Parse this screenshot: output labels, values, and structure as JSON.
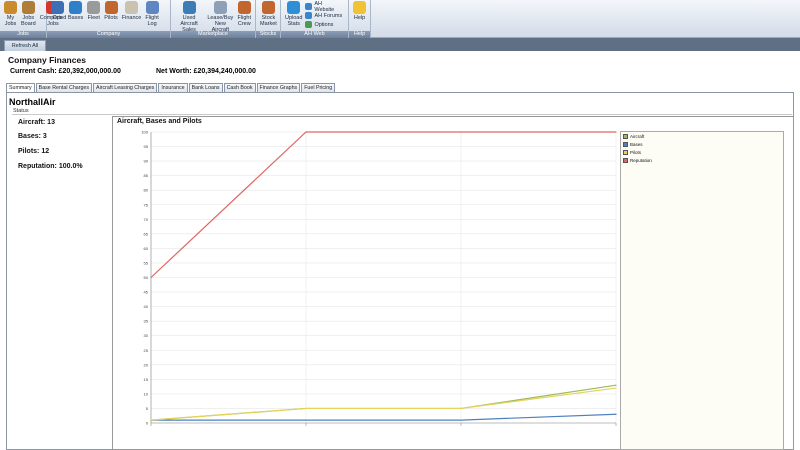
{
  "ribbon": {
    "groups": [
      {
        "label": "Jobs",
        "buttons": [
          {
            "label": "My\nJobs",
            "icon": "briefcase-icon",
            "color": "#c98b2c"
          },
          {
            "label": "Jobs\nBoard",
            "icon": "clipboard-icon",
            "color": "#b07c3a"
          },
          {
            "label": "Completed\nJobs",
            "icon": "checkmark-icon",
            "color": "#d6352b"
          }
        ]
      },
      {
        "label": "Company",
        "buttons": [
          {
            "label": "Ops",
            "icon": "people-icon",
            "color": "#3c6fb6"
          },
          {
            "label": "Bases",
            "icon": "globe-icon",
            "color": "#2f7fc9"
          },
          {
            "label": "Fleet",
            "icon": "airplane-icon",
            "color": "#9a9a9a"
          },
          {
            "label": "Pilots",
            "icon": "pilot-icon",
            "color": "#c0662e"
          },
          {
            "label": "Finance",
            "icon": "money-icon",
            "color": "#c9c2b0"
          },
          {
            "label": "Flight\nLog",
            "icon": "logbook-icon",
            "color": "#5e86c2"
          }
        ]
      },
      {
        "label": "Marketplace",
        "buttons": [
          {
            "label": "Used Aircraft\nSales",
            "icon": "sales-icon",
            "color": "#3d7db5"
          },
          {
            "label": "Lease/Buy\nNew Aircraft",
            "icon": "new-aircraft-icon",
            "color": "#8da0b8"
          },
          {
            "label": "Flight\nCrew",
            "icon": "crew-icon",
            "color": "#c0662e"
          }
        ]
      },
      {
        "label": "Stocks",
        "buttons": [
          {
            "label": "Stock\nMarket",
            "icon": "stock-icon",
            "color": "#c0662e"
          }
        ]
      },
      {
        "label": "AH Web",
        "buttons": [
          {
            "label": "Upload\nStats",
            "icon": "upload-icon",
            "color": "#2f8fd6"
          }
        ],
        "small": [
          {
            "label": "AH Website",
            "icon": "link-icon",
            "color": "#3a84c9"
          },
          {
            "label": "AH Forums",
            "icon": "forum-icon",
            "color": "#3a84c9"
          },
          {
            "label": "Options",
            "icon": "options-icon",
            "color": "#4a9b4a"
          }
        ]
      },
      {
        "label": "Help",
        "buttons": [
          {
            "label": "Help",
            "icon": "lightbulb-icon",
            "color": "#f1c232"
          }
        ]
      }
    ]
  },
  "refresh_label": "Refresh All",
  "page": {
    "title": "Company Finances",
    "current_cash": "Current Cash: £20,392,000,000.00",
    "net_worth": "Net Worth: £20,394,240,000.00"
  },
  "tabs": [
    "Summary",
    "Base Rental Charges",
    "Aircraft Leasing Charges",
    "Insurance",
    "Bank Loans",
    "Cash Book",
    "Finance Graphs",
    "Fuel Pricing"
  ],
  "company": {
    "name": "NorthallAir",
    "status_label": "Status",
    "aircraft": "Aircraft: 13",
    "bases": "Bases: 3",
    "pilots": "Pilots: 12",
    "reputation": "Reputation: 100.0%"
  },
  "chart_data": {
    "type": "line",
    "title": "Aircraft, Bases and Pilots",
    "ylim": [
      0,
      100
    ],
    "yticks": [
      0,
      5,
      10,
      15,
      20,
      25,
      30,
      35,
      40,
      45,
      50,
      55,
      60,
      65,
      70,
      75,
      80,
      85,
      90,
      95,
      100
    ],
    "x": [
      0,
      1,
      2,
      3
    ],
    "xtick_labels": [
      "",
      "",
      "",
      ""
    ],
    "grid": true,
    "legend": "right",
    "series": [
      {
        "name": "Aircraft",
        "color": "#9bbb59",
        "values": [
          1,
          5,
          5,
          13
        ]
      },
      {
        "name": "Bases",
        "color": "#4f81bd",
        "values": [
          1,
          1,
          1,
          3
        ]
      },
      {
        "name": "Pilots",
        "color": "#e6d35a",
        "values": [
          1,
          5,
          5,
          12
        ]
      },
      {
        "name": "Reputation",
        "color": "#e06666",
        "values": [
          50,
          100,
          100,
          100
        ]
      }
    ]
  }
}
